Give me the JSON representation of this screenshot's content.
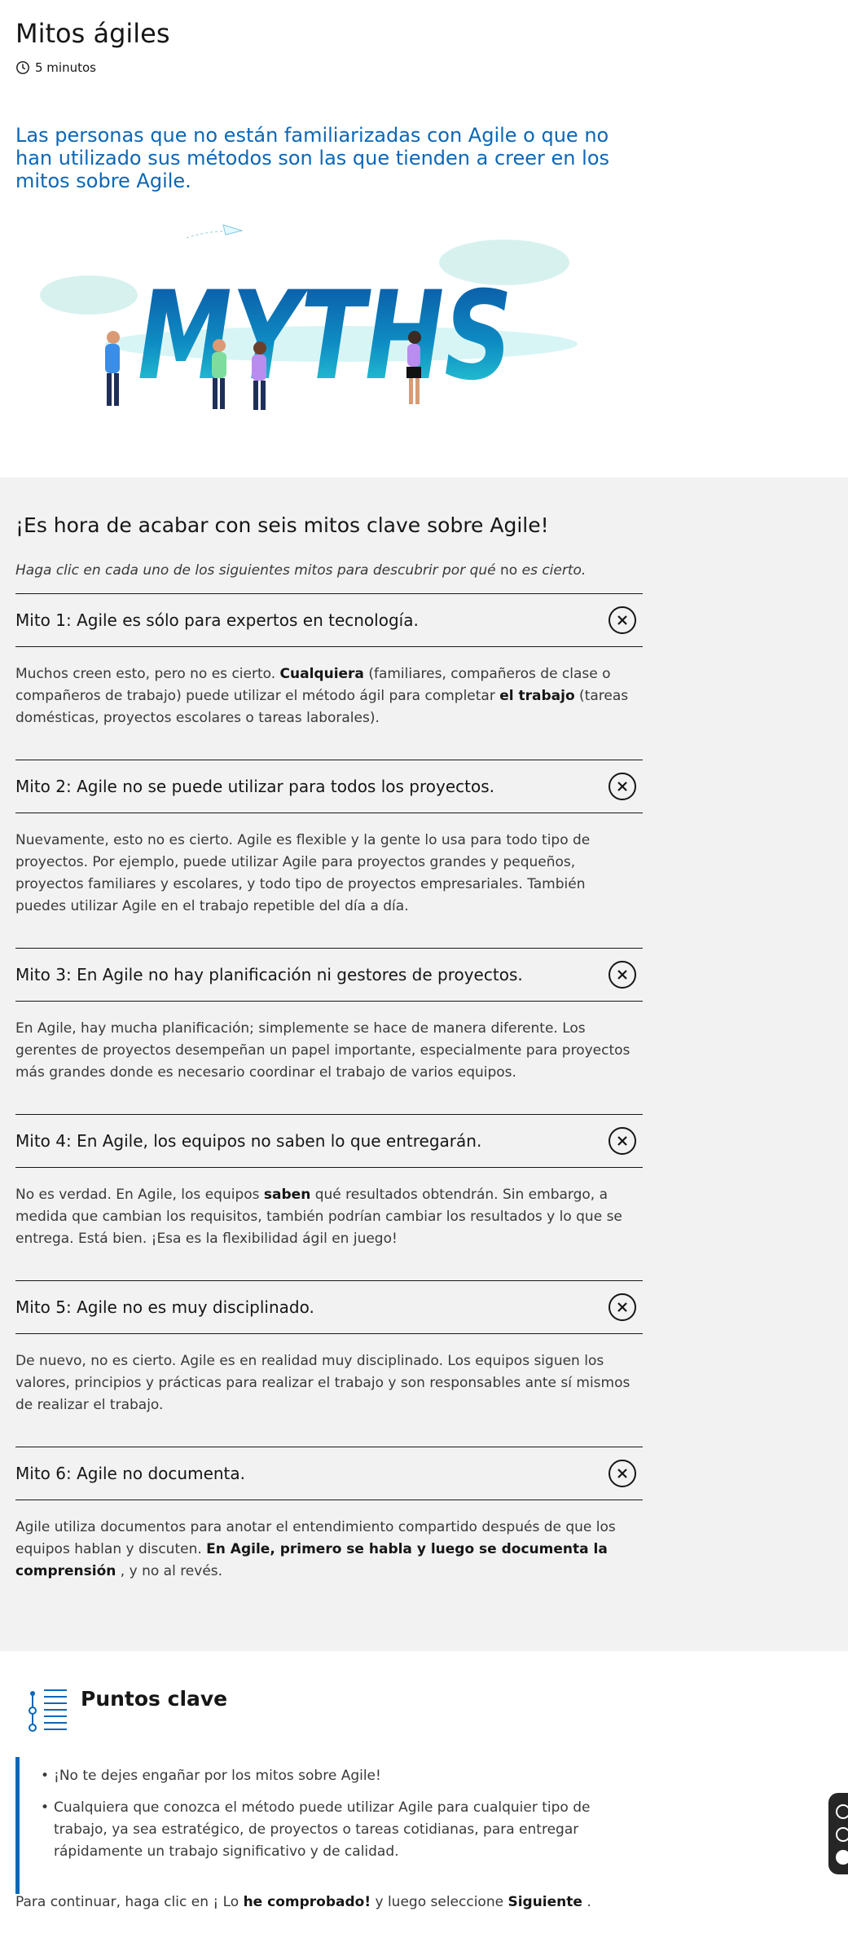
{
  "page": {
    "title": "Mitos ágiles",
    "duration": "5 minutos",
    "intro": "Las personas que no están familiarizadas con Agile o que no han utilizado sus métodos son las que tienden a creer en los mitos sobre Agile.",
    "illustration_text": "MYTHS"
  },
  "myths_section": {
    "heading": "¡Es hora de acabar con seis mitos clave sobre Agile!",
    "instructions_italic_1": "Haga clic en cada uno de los siguientes mitos para descubrir por qué",
    "instructions_plain": " no ",
    "instructions_italic_2": "es cierto.",
    "items": [
      {
        "title": "Mito 1: Agile es sólo para expertos en tecnología.",
        "body_parts": [
          {
            "t": "Muchos creen esto, pero no es cierto. ",
            "b": false
          },
          {
            "t": "Cualquiera",
            "b": true
          },
          {
            "t": " (familiares, compañeros de clase o compañeros de trabajo) puede utilizar el método ágil para completar ",
            "b": false
          },
          {
            "t": "el trabajo",
            "b": true
          },
          {
            "t": " (tareas domésticas, proyectos escolares o tareas laborales).",
            "b": false
          }
        ]
      },
      {
        "title": "Mito 2: Agile no se puede utilizar para todos los proyectos.",
        "body_parts": [
          {
            "t": "Nuevamente, esto no es cierto. Agile es flexible y la gente lo usa para todo tipo de proyectos. Por ejemplo, puede utilizar Agile para proyectos grandes y pequeños, proyectos familiares y escolares, y todo tipo de proyectos empresariales. También puedes utilizar Agile en el trabajo repetible del día a día.",
            "b": false
          }
        ]
      },
      {
        "title": "Mito 3: En Agile no hay planificación ni gestores de proyectos.",
        "body_parts": [
          {
            "t": "En Agile, hay mucha planificación; simplemente se hace de manera diferente. Los gerentes de proyectos desempeñan un papel importante, especialmente para proyectos más grandes donde es necesario coordinar el trabajo de varios equipos.",
            "b": false
          }
        ]
      },
      {
        "title": "Mito 4: En Agile, los equipos no saben lo que entregarán.",
        "body_parts": [
          {
            "t": "No es verdad. En Agile, los equipos ",
            "b": false
          },
          {
            "t": "saben",
            "b": true
          },
          {
            "t": " qué resultados obtendrán. Sin embargo, a medida que cambian los requisitos, también podrían cambiar los resultados y lo que se entrega. Está bien. ¡Esa es la flexibilidad ágil en juego!",
            "b": false
          }
        ]
      },
      {
        "title": "Mito 5: Agile no es muy disciplinado.",
        "body_parts": [
          {
            "t": "De nuevo, no es cierto. Agile es en realidad muy disciplinado. Los equipos siguen los valores, principios y prácticas para realizar el trabajo y son responsables ante sí mismos de realizar el trabajo.",
            "b": false
          }
        ]
      },
      {
        "title": "Mito 6: Agile no documenta.",
        "body_parts": [
          {
            "t": "Agile utiliza documentos para anotar el entendimiento compartido después de que los equipos hablan y discuten. ",
            "b": false
          },
          {
            "t": "En Agile, primero se habla y luego se documenta la comprensión",
            "b": true
          },
          {
            "t": " , y no al revés.",
            "b": false
          }
        ]
      }
    ]
  },
  "key_points": {
    "title": "Puntos clave",
    "bullets": [
      "¡No te dejes engañar por los mitos sobre Agile!",
      "Cualquiera que conozca el método puede utilizar Agile para cualquier tipo de trabajo, ya sea estratégico, de proyectos o tareas cotidianas, para entregar rápidamente un trabajo significativo y de calidad."
    ],
    "footer_1": "Para continuar, haga clic en ¡ Lo ",
    "footer_bold_1": "he comprobado!",
    "footer_2": " y luego seleccione  ",
    "footer_bold_2": "Siguiente",
    "footer_3": " ."
  },
  "colors": {
    "accent": "#0b67b8",
    "section_bg": "#f2f2f2",
    "text": "#161616"
  }
}
